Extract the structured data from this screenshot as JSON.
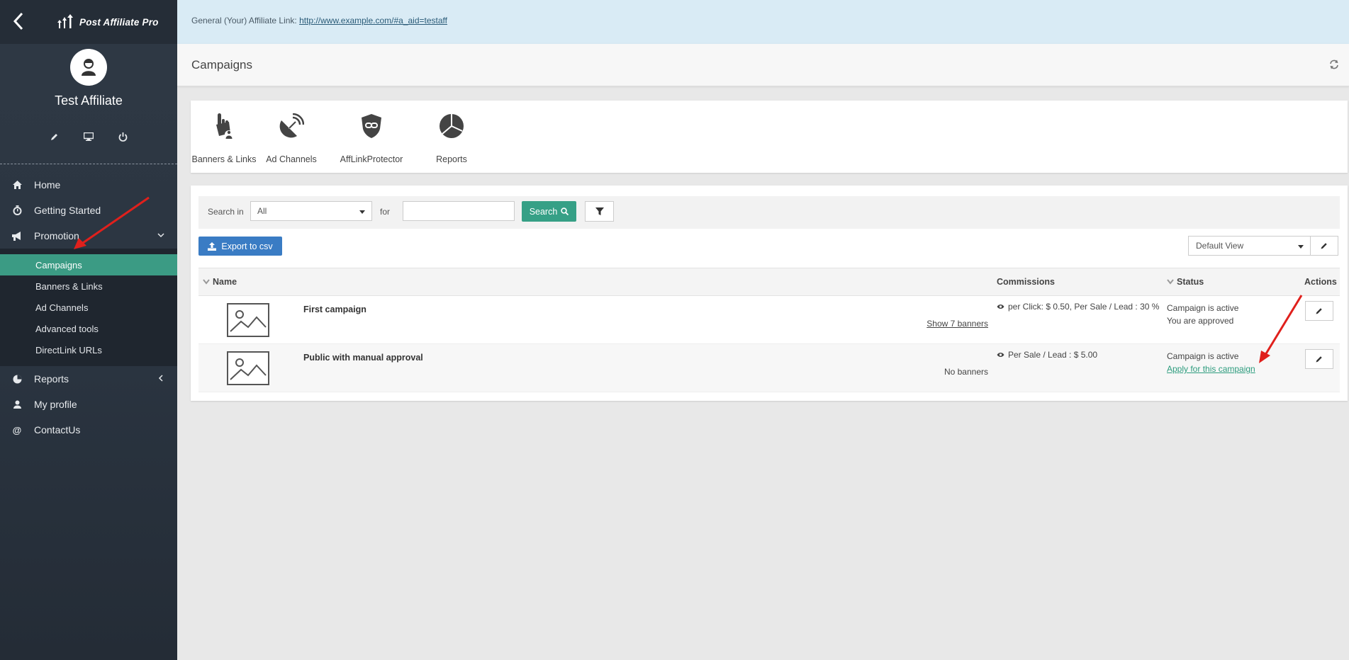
{
  "app": {
    "logo_text": "Post Affiliate Pro",
    "user_name": "Test Affiliate"
  },
  "colors": {
    "sidebar_bg": "#2a3440",
    "accent_green": "#3b9b84",
    "export_blue": "#3a7cc4",
    "topbar_bg": "#d9ebf5",
    "annotation_red": "#e0201c"
  },
  "icons": {
    "back": "chevron-left-icon",
    "user_actions": [
      "pencil-icon",
      "monitor-icon",
      "power-icon"
    ]
  },
  "sidebar": {
    "items": [
      {
        "label": "Home",
        "icon": "home-icon"
      },
      {
        "label": "Getting Started",
        "icon": "stopwatch-icon"
      },
      {
        "label": "Promotion",
        "icon": "megaphone-icon",
        "expanded": true
      }
    ],
    "sub_items": [
      {
        "label": "Campaigns",
        "active": true
      },
      {
        "label": "Banners & Links"
      },
      {
        "label": "Ad Channels"
      },
      {
        "label": "Advanced tools"
      },
      {
        "label": "DirectLink URLs"
      }
    ],
    "items_after": [
      {
        "label": "Reports",
        "icon": "pie-chart-icon"
      },
      {
        "label": "My profile",
        "icon": "user-icon"
      },
      {
        "label": "ContactUs",
        "icon": "at-icon"
      }
    ]
  },
  "topbar": {
    "prefix": "General (Your) Affiliate Link: ",
    "link": "http://www.example.com/#a_aid=testaff"
  },
  "page": {
    "title": "Campaigns"
  },
  "quick_icons": [
    {
      "label": "Banners & Links",
      "icon": "hand-pointer-icon"
    },
    {
      "label": "Ad Channels",
      "icon": "satellite-dish-icon"
    },
    {
      "label": "AffLinkProtector",
      "icon": "shield-link-icon"
    },
    {
      "label": "Reports",
      "icon": "pie-chart-icon"
    }
  ],
  "filter": {
    "search_in_label": "Search in",
    "search_in_value": "All",
    "for_label": "for",
    "for_value": "",
    "search_button": "Search"
  },
  "toolbar": {
    "export_label": "Export to csv",
    "view_value": "Default View"
  },
  "table": {
    "headers": {
      "name": "Name",
      "commissions": "Commissions",
      "status": "Status",
      "actions": "Actions"
    },
    "rows": [
      {
        "name": "First campaign",
        "banners": "Show 7 banners",
        "commissions": "per Click: $ 0.50, Per Sale / Lead : 30 %",
        "status_line1": "Campaign is active",
        "status_line2": "You are approved"
      },
      {
        "name": "Public with manual approval",
        "banners": "No banners",
        "commissions": "Per Sale / Lead : $ 5.00",
        "status_line1": "Campaign is active",
        "status_line2": "Apply for this campaign"
      }
    ]
  }
}
